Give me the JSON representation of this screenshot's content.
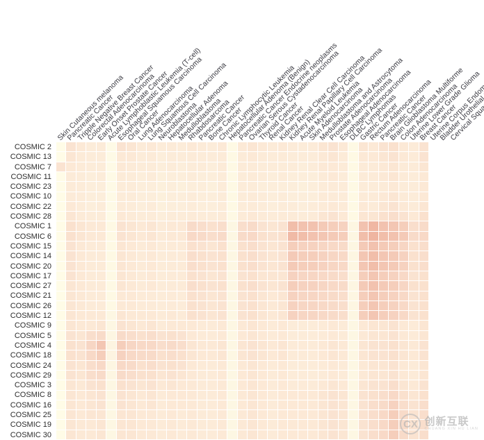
{
  "figure": {
    "type": "heatmap",
    "colors": {
      "low": "#fffde8",
      "mid": "#fbe4d5",
      "high": "#e8998a",
      "gridline": "#ffffff",
      "background": "#ffffff",
      "text": "#2b2b2b"
    }
  },
  "watermark": {
    "glyph": "CX",
    "cn": "创新互联",
    "en": "CHUANG XIN HU LIAN"
  },
  "chart_data": {
    "type": "heatmap",
    "title": "",
    "xlabel": "",
    "ylabel": "",
    "grid": true,
    "legend": "none",
    "zlim": [
      0,
      1
    ],
    "colorscale": [
      "#fffde8",
      "#fdf0e3",
      "#fbe4d5",
      "#f3c4b3",
      "#e8998a"
    ],
    "x": [
      "Skin Cutaneous melanoma",
      "Pancreatic Cancer",
      "Tripple Negative Breast Cancer",
      "Colorectal Adenocarcinoma",
      "Early Onset Prostate Cancer",
      "Acute Lymphoblastic Leukemia (T-cell)",
      "Esophageal Squamous Carcinoma",
      "Oral Cancer",
      "Lung Adenocarcinoma",
      "Lung Squamous Cell Carcinoma",
      "Neuroblastoma",
      "Hepatocellular Adenoma",
      "Medulloblastoma",
      "Rhabdosarcoma",
      "Pancreatic Cancer",
      "Bone Cancer",
      "Chronic Lymphocytic Leukemia",
      "Hepatocellular Adenoma (Benign)",
      "Pancreatic Cancer Endocrine neoplasms",
      "Ovarian Serous Cystadenocarcinoma",
      "Thyroid Cancer",
      "Renal Cancer",
      "Kidney Renal Clear Cell Carcinoma",
      "Kidney Renal Papillary Cell Carcinoma",
      "Acute Myeloid Leukemia",
      "Skin Adenocarcinoma",
      "Medulloblastoma and Astrocytoma",
      "Prostate Adenocarcinoma",
      "Esophageal Adenocarcinoma",
      "DLBC Lymphomas",
      "Gastric Cancer",
      "Rectum Adenocarcinoma",
      "Pancreatic Cancer",
      "Brain Glioblastoma Multiforme",
      "Colon Adenocarcinoma",
      "Uterine Lower Grade Glioma",
      "Breast Cancer",
      "Uterine Corpus Endometrial Carcinoma",
      "Bladder Urothelial Carcinoma",
      "Cervical Squamous"
    ],
    "y": [
      "COSMIC 2",
      "COSMIC 13",
      "COSMIC 7",
      "COSMIC 11",
      "COSMIC 23",
      "COSMIC 10",
      "COSMIC 22",
      "COSMIC 28",
      "COSMIC 1",
      "COSMIC 6",
      "COSMIC 15",
      "COSMIC 14",
      "COSMIC 20",
      "COSMIC 17",
      "COSMIC 27",
      "COSMIC 21",
      "COSMIC 26",
      "COSMIC 12",
      "COSMIC 9",
      "COSMIC 5",
      "COSMIC 4",
      "COSMIC 18",
      "COSMIC 24",
      "COSMIC 29",
      "COSMIC 3",
      "COSMIC 8",
      "COSMIC 16",
      "COSMIC 25",
      "COSMIC 19",
      "COSMIC 30"
    ],
    "z": [
      [
        0.02,
        0.3,
        0.26,
        0.22,
        0.24,
        0.04,
        0.3,
        0.28,
        0.24,
        0.26,
        0.22,
        0.24,
        0.22,
        0.26,
        0.24,
        0.22,
        0.26,
        0.06,
        0.26,
        0.28,
        0.26,
        0.24,
        0.26,
        0.24,
        0.22,
        0.24,
        0.28,
        0.3,
        0.26,
        0.06,
        0.28,
        0.26,
        0.3,
        0.32,
        0.26,
        0.24,
        0.3
      ],
      [
        0.02,
        0.28,
        0.24,
        0.22,
        0.22,
        0.04,
        0.26,
        0.26,
        0.22,
        0.24,
        0.2,
        0.22,
        0.22,
        0.24,
        0.22,
        0.22,
        0.24,
        0.06,
        0.24,
        0.26,
        0.24,
        0.22,
        0.24,
        0.22,
        0.22,
        0.22,
        0.26,
        0.28,
        0.24,
        0.06,
        0.26,
        0.26,
        0.28,
        0.3,
        0.26,
        0.24,
        0.3
      ],
      [
        0.3,
        0.26,
        0.24,
        0.22,
        0.22,
        0.04,
        0.26,
        0.24,
        0.22,
        0.22,
        0.2,
        0.22,
        0.2,
        0.22,
        0.22,
        0.2,
        0.24,
        0.06,
        0.24,
        0.24,
        0.22,
        0.22,
        0.22,
        0.22,
        0.2,
        0.22,
        0.26,
        0.26,
        0.24,
        0.06,
        0.24,
        0.24,
        0.26,
        0.28,
        0.24,
        0.24,
        0.28
      ],
      [
        0.02,
        0.24,
        0.22,
        0.2,
        0.22,
        0.04,
        0.24,
        0.22,
        0.2,
        0.22,
        0.18,
        0.2,
        0.2,
        0.22,
        0.2,
        0.2,
        0.22,
        0.06,
        0.22,
        0.24,
        0.22,
        0.2,
        0.22,
        0.2,
        0.2,
        0.2,
        0.24,
        0.26,
        0.22,
        0.06,
        0.24,
        0.24,
        0.26,
        0.28,
        0.24,
        0.22,
        0.26
      ],
      [
        0.02,
        0.24,
        0.22,
        0.2,
        0.2,
        0.04,
        0.22,
        0.22,
        0.2,
        0.2,
        0.18,
        0.2,
        0.18,
        0.2,
        0.2,
        0.18,
        0.22,
        0.06,
        0.22,
        0.22,
        0.2,
        0.2,
        0.2,
        0.2,
        0.18,
        0.2,
        0.22,
        0.24,
        0.22,
        0.06,
        0.22,
        0.22,
        0.24,
        0.26,
        0.22,
        0.22,
        0.26
      ],
      [
        0.02,
        0.24,
        0.22,
        0.2,
        0.2,
        0.04,
        0.22,
        0.22,
        0.2,
        0.2,
        0.18,
        0.2,
        0.2,
        0.22,
        0.2,
        0.2,
        0.22,
        0.06,
        0.22,
        0.24,
        0.22,
        0.2,
        0.22,
        0.2,
        0.2,
        0.2,
        0.24,
        0.24,
        0.22,
        0.06,
        0.24,
        0.24,
        0.26,
        0.28,
        0.24,
        0.22,
        0.26
      ],
      [
        0.02,
        0.26,
        0.22,
        0.2,
        0.22,
        0.04,
        0.24,
        0.22,
        0.2,
        0.22,
        0.18,
        0.2,
        0.2,
        0.22,
        0.2,
        0.2,
        0.22,
        0.06,
        0.22,
        0.24,
        0.22,
        0.2,
        0.22,
        0.22,
        0.2,
        0.22,
        0.24,
        0.26,
        0.24,
        0.06,
        0.26,
        0.24,
        0.28,
        0.3,
        0.26,
        0.24,
        0.28
      ],
      [
        0.02,
        0.28,
        0.24,
        0.22,
        0.22,
        0.04,
        0.26,
        0.24,
        0.22,
        0.22,
        0.2,
        0.22,
        0.22,
        0.24,
        0.22,
        0.22,
        0.24,
        0.06,
        0.24,
        0.26,
        0.24,
        0.22,
        0.24,
        0.24,
        0.22,
        0.24,
        0.28,
        0.3,
        0.26,
        0.06,
        0.28,
        0.28,
        0.32,
        0.34,
        0.3,
        0.26,
        0.32
      ],
      [
        0.02,
        0.32,
        0.28,
        0.26,
        0.26,
        0.06,
        0.3,
        0.28,
        0.26,
        0.28,
        0.24,
        0.26,
        0.26,
        0.36,
        0.34,
        0.32,
        0.34,
        0.08,
        0.34,
        0.36,
        0.3,
        0.28,
        0.3,
        0.52,
        0.5,
        0.5,
        0.46,
        0.44,
        0.42,
        0.1,
        0.5,
        0.56,
        0.5,
        0.48,
        0.44,
        0.34,
        0.36
      ],
      [
        0.02,
        0.32,
        0.28,
        0.26,
        0.26,
        0.06,
        0.3,
        0.28,
        0.26,
        0.28,
        0.24,
        0.26,
        0.26,
        0.38,
        0.36,
        0.34,
        0.36,
        0.08,
        0.36,
        0.38,
        0.32,
        0.3,
        0.32,
        0.54,
        0.52,
        0.5,
        0.48,
        0.46,
        0.44,
        0.1,
        0.52,
        0.58,
        0.52,
        0.5,
        0.46,
        0.36,
        0.38
      ],
      [
        0.02,
        0.3,
        0.26,
        0.24,
        0.24,
        0.06,
        0.28,
        0.26,
        0.24,
        0.26,
        0.22,
        0.24,
        0.24,
        0.32,
        0.3,
        0.28,
        0.32,
        0.08,
        0.32,
        0.34,
        0.3,
        0.28,
        0.3,
        0.44,
        0.42,
        0.42,
        0.4,
        0.38,
        0.36,
        0.1,
        0.46,
        0.5,
        0.46,
        0.44,
        0.4,
        0.32,
        0.34
      ],
      [
        0.02,
        0.3,
        0.26,
        0.24,
        0.24,
        0.06,
        0.28,
        0.26,
        0.24,
        0.26,
        0.22,
        0.24,
        0.24,
        0.34,
        0.32,
        0.3,
        0.32,
        0.08,
        0.32,
        0.34,
        0.3,
        0.28,
        0.3,
        0.46,
        0.44,
        0.44,
        0.42,
        0.4,
        0.38,
        0.1,
        0.48,
        0.52,
        0.48,
        0.46,
        0.42,
        0.32,
        0.34
      ],
      [
        0.02,
        0.3,
        0.26,
        0.24,
        0.24,
        0.06,
        0.28,
        0.26,
        0.24,
        0.26,
        0.22,
        0.24,
        0.24,
        0.34,
        0.32,
        0.3,
        0.32,
        0.08,
        0.32,
        0.34,
        0.3,
        0.28,
        0.3,
        0.46,
        0.44,
        0.44,
        0.42,
        0.4,
        0.38,
        0.1,
        0.48,
        0.52,
        0.48,
        0.46,
        0.42,
        0.32,
        0.34
      ],
      [
        0.02,
        0.3,
        0.26,
        0.24,
        0.24,
        0.06,
        0.28,
        0.26,
        0.24,
        0.26,
        0.22,
        0.24,
        0.24,
        0.32,
        0.3,
        0.28,
        0.3,
        0.08,
        0.3,
        0.32,
        0.28,
        0.28,
        0.28,
        0.42,
        0.4,
        0.4,
        0.38,
        0.36,
        0.34,
        0.1,
        0.44,
        0.48,
        0.44,
        0.42,
        0.38,
        0.3,
        0.32
      ],
      [
        0.02,
        0.28,
        0.26,
        0.24,
        0.24,
        0.06,
        0.28,
        0.26,
        0.24,
        0.26,
        0.22,
        0.24,
        0.24,
        0.34,
        0.32,
        0.3,
        0.32,
        0.08,
        0.32,
        0.34,
        0.3,
        0.28,
        0.3,
        0.44,
        0.42,
        0.42,
        0.4,
        0.38,
        0.36,
        0.1,
        0.46,
        0.5,
        0.46,
        0.44,
        0.4,
        0.32,
        0.32
      ],
      [
        0.02,
        0.28,
        0.26,
        0.24,
        0.24,
        0.06,
        0.26,
        0.26,
        0.24,
        0.24,
        0.22,
        0.24,
        0.22,
        0.32,
        0.3,
        0.28,
        0.3,
        0.08,
        0.3,
        0.32,
        0.28,
        0.26,
        0.28,
        0.42,
        0.4,
        0.4,
        0.38,
        0.36,
        0.34,
        0.1,
        0.44,
        0.48,
        0.44,
        0.42,
        0.38,
        0.3,
        0.32
      ],
      [
        0.02,
        0.28,
        0.26,
        0.24,
        0.24,
        0.06,
        0.26,
        0.26,
        0.24,
        0.24,
        0.22,
        0.24,
        0.22,
        0.32,
        0.3,
        0.28,
        0.3,
        0.08,
        0.3,
        0.32,
        0.28,
        0.26,
        0.28,
        0.42,
        0.4,
        0.4,
        0.38,
        0.36,
        0.34,
        0.1,
        0.44,
        0.48,
        0.44,
        0.42,
        0.38,
        0.3,
        0.32
      ],
      [
        0.02,
        0.28,
        0.26,
        0.26,
        0.26,
        0.08,
        0.28,
        0.26,
        0.26,
        0.26,
        0.24,
        0.26,
        0.24,
        0.32,
        0.3,
        0.28,
        0.3,
        0.08,
        0.3,
        0.32,
        0.28,
        0.26,
        0.28,
        0.42,
        0.4,
        0.4,
        0.38,
        0.36,
        0.34,
        0.1,
        0.44,
        0.48,
        0.44,
        0.42,
        0.38,
        0.3,
        0.32
      ],
      [
        0.02,
        0.28,
        0.26,
        0.26,
        0.28,
        0.08,
        0.3,
        0.28,
        0.26,
        0.28,
        0.24,
        0.26,
        0.26,
        0.26,
        0.24,
        0.24,
        0.26,
        0.08,
        0.26,
        0.28,
        0.26,
        0.24,
        0.26,
        0.22,
        0.22,
        0.22,
        0.24,
        0.26,
        0.24,
        0.08,
        0.26,
        0.28,
        0.28,
        0.3,
        0.26,
        0.24,
        0.28
      ],
      [
        0.02,
        0.3,
        0.28,
        0.34,
        0.36,
        0.1,
        0.36,
        0.34,
        0.32,
        0.34,
        0.3,
        0.32,
        0.3,
        0.26,
        0.24,
        0.24,
        0.26,
        0.08,
        0.26,
        0.28,
        0.26,
        0.24,
        0.26,
        0.22,
        0.22,
        0.22,
        0.24,
        0.26,
        0.24,
        0.08,
        0.26,
        0.28,
        0.28,
        0.3,
        0.26,
        0.24,
        0.28
      ],
      [
        0.02,
        0.32,
        0.3,
        0.4,
        0.48,
        0.12,
        0.44,
        0.4,
        0.38,
        0.38,
        0.34,
        0.36,
        0.34,
        0.28,
        0.26,
        0.26,
        0.28,
        0.08,
        0.28,
        0.3,
        0.28,
        0.26,
        0.28,
        0.24,
        0.24,
        0.24,
        0.26,
        0.28,
        0.26,
        0.08,
        0.28,
        0.3,
        0.3,
        0.32,
        0.28,
        0.26,
        0.3
      ],
      [
        0.02,
        0.32,
        0.3,
        0.38,
        0.44,
        0.12,
        0.42,
        0.38,
        0.36,
        0.36,
        0.32,
        0.34,
        0.32,
        0.28,
        0.26,
        0.26,
        0.28,
        0.08,
        0.28,
        0.3,
        0.28,
        0.26,
        0.28,
        0.24,
        0.24,
        0.24,
        0.26,
        0.28,
        0.26,
        0.08,
        0.28,
        0.3,
        0.3,
        0.32,
        0.28,
        0.26,
        0.3
      ],
      [
        0.02,
        0.3,
        0.28,
        0.34,
        0.38,
        0.1,
        0.38,
        0.36,
        0.32,
        0.34,
        0.3,
        0.32,
        0.3,
        0.26,
        0.24,
        0.24,
        0.26,
        0.08,
        0.26,
        0.28,
        0.26,
        0.24,
        0.26,
        0.22,
        0.22,
        0.22,
        0.24,
        0.26,
        0.24,
        0.08,
        0.26,
        0.28,
        0.28,
        0.3,
        0.26,
        0.24,
        0.28
      ],
      [
        0.02,
        0.3,
        0.28,
        0.34,
        0.36,
        0.1,
        0.36,
        0.34,
        0.32,
        0.32,
        0.28,
        0.3,
        0.28,
        0.26,
        0.24,
        0.24,
        0.26,
        0.08,
        0.26,
        0.28,
        0.26,
        0.24,
        0.26,
        0.22,
        0.22,
        0.22,
        0.24,
        0.26,
        0.24,
        0.08,
        0.26,
        0.28,
        0.28,
        0.3,
        0.26,
        0.24,
        0.28
      ],
      [
        0.02,
        0.28,
        0.26,
        0.3,
        0.32,
        0.08,
        0.32,
        0.3,
        0.28,
        0.3,
        0.26,
        0.28,
        0.26,
        0.26,
        0.24,
        0.24,
        0.26,
        0.08,
        0.26,
        0.28,
        0.26,
        0.24,
        0.26,
        0.24,
        0.24,
        0.24,
        0.26,
        0.28,
        0.26,
        0.08,
        0.28,
        0.3,
        0.3,
        0.34,
        0.28,
        0.26,
        0.3
      ],
      [
        0.02,
        0.28,
        0.26,
        0.28,
        0.3,
        0.08,
        0.3,
        0.28,
        0.26,
        0.28,
        0.24,
        0.26,
        0.26,
        0.26,
        0.24,
        0.24,
        0.26,
        0.08,
        0.26,
        0.28,
        0.26,
        0.24,
        0.26,
        0.26,
        0.26,
        0.26,
        0.28,
        0.3,
        0.28,
        0.08,
        0.3,
        0.32,
        0.34,
        0.38,
        0.32,
        0.28,
        0.32
      ],
      [
        0.02,
        0.28,
        0.26,
        0.28,
        0.3,
        0.08,
        0.3,
        0.28,
        0.26,
        0.28,
        0.24,
        0.26,
        0.26,
        0.26,
        0.24,
        0.24,
        0.26,
        0.08,
        0.26,
        0.28,
        0.26,
        0.24,
        0.26,
        0.26,
        0.26,
        0.26,
        0.28,
        0.3,
        0.28,
        0.08,
        0.3,
        0.34,
        0.36,
        0.42,
        0.34,
        0.3,
        0.34
      ],
      [
        0.02,
        0.28,
        0.26,
        0.28,
        0.28,
        0.08,
        0.28,
        0.28,
        0.26,
        0.26,
        0.24,
        0.26,
        0.24,
        0.26,
        0.24,
        0.24,
        0.26,
        0.08,
        0.26,
        0.28,
        0.26,
        0.24,
        0.26,
        0.26,
        0.26,
        0.26,
        0.28,
        0.3,
        0.28,
        0.08,
        0.3,
        0.34,
        0.38,
        0.44,
        0.36,
        0.3,
        0.34
      ],
      [
        0.02,
        0.28,
        0.26,
        0.26,
        0.28,
        0.08,
        0.28,
        0.28,
        0.26,
        0.26,
        0.24,
        0.26,
        0.24,
        0.26,
        0.24,
        0.24,
        0.26,
        0.08,
        0.26,
        0.28,
        0.26,
        0.24,
        0.26,
        0.26,
        0.26,
        0.26,
        0.28,
        0.3,
        0.28,
        0.08,
        0.3,
        0.34,
        0.38,
        0.44,
        0.36,
        0.3,
        0.34
      ],
      [
        0.02,
        0.28,
        0.26,
        0.26,
        0.28,
        0.08,
        0.28,
        0.28,
        0.26,
        0.26,
        0.24,
        0.26,
        0.24,
        0.26,
        0.24,
        0.24,
        0.26,
        0.08,
        0.26,
        0.28,
        0.26,
        0.24,
        0.26,
        0.26,
        0.26,
        0.26,
        0.28,
        0.3,
        0.28,
        0.08,
        0.3,
        0.34,
        0.38,
        0.44,
        0.36,
        0.3,
        0.34
      ]
    ]
  }
}
